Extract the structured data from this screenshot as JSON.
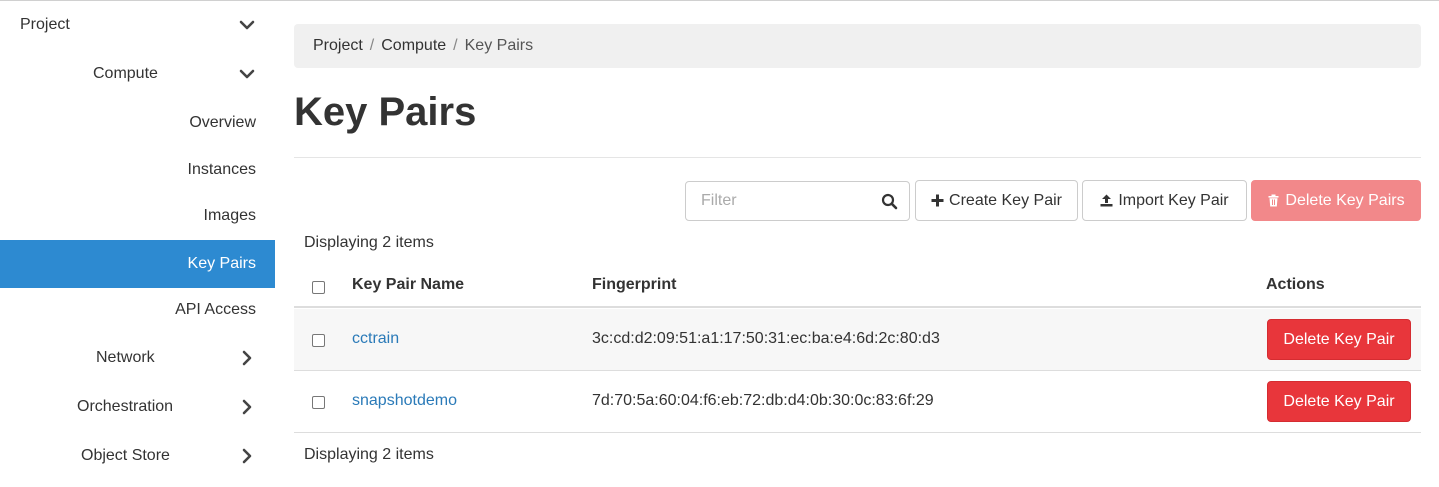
{
  "sidebar": {
    "items": [
      {
        "label": "Project",
        "chevron": "down"
      },
      {
        "label": "Compute",
        "chevron": "down"
      },
      {
        "label": "Overview"
      },
      {
        "label": "Instances"
      },
      {
        "label": "Images"
      },
      {
        "label": "Key Pairs",
        "active": true
      },
      {
        "label": "API Access"
      },
      {
        "label": "Network",
        "chevron": "right"
      },
      {
        "label": "Orchestration",
        "chevron": "right"
      },
      {
        "label": "Object Store",
        "chevron": "right"
      }
    ]
  },
  "breadcrumb": [
    "Project",
    "Compute",
    "Key Pairs"
  ],
  "page_title": "Key Pairs",
  "filter": {
    "placeholder": "Filter",
    "value": ""
  },
  "toolbar": {
    "create_label": "Create Key Pair",
    "import_label": "Import Key Pair",
    "delete_label": "Delete Key Pairs"
  },
  "table": {
    "count_text": "Displaying 2 items",
    "columns": [
      "Key Pair Name",
      "Fingerprint",
      "Actions"
    ],
    "rows": [
      {
        "name": "cctrain",
        "fingerprint": "3c:cd:d2:09:51:a1:17:50:31:ec:ba:e4:6d:2c:80:d3",
        "action": "Delete Key Pair"
      },
      {
        "name": "snapshotdemo",
        "fingerprint": "7d:70:5a:60:04:f6:eb:72:db:d4:0b:30:0c:83:6f:29",
        "action": "Delete Key Pair"
      }
    ]
  },
  "colors": {
    "active_nav": "#2d8ad1",
    "danger": "#e8363b",
    "danger_disabled": "#f2888a",
    "link": "#2a7ab8"
  },
  "icons": [
    "chevron-down-icon",
    "chevron-right-icon",
    "search-icon",
    "plus-icon",
    "upload-icon",
    "trash-icon"
  ]
}
